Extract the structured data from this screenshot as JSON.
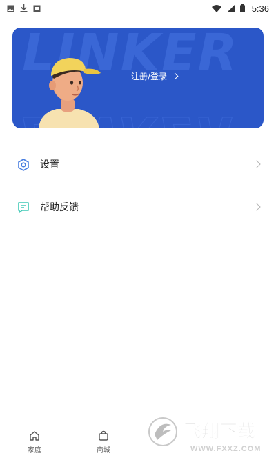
{
  "status_bar": {
    "time": "5:36",
    "left_icons": [
      "image-icon",
      "download-icon",
      "app-notification-icon"
    ],
    "right_icons": [
      "wifi-icon",
      "signal-icon",
      "battery-icon"
    ]
  },
  "banner": {
    "brand_text": "LINKER",
    "login_label": "注册/登录",
    "background_color": "#2b57c8"
  },
  "menu": {
    "items": [
      {
        "label": "设置",
        "icon": "settings-icon",
        "icon_color": "#4a7fe0"
      },
      {
        "label": "帮助反馈",
        "icon": "feedback-icon",
        "icon_color": "#3fc9b6"
      }
    ]
  },
  "tab_bar": {
    "tabs": [
      {
        "label": "家庭",
        "icon": "home-icon"
      },
      {
        "label": "商城",
        "icon": "shop-bag-icon"
      }
    ]
  },
  "watermark": {
    "title": "飞翔下载",
    "subtitle": "WWW.FXXZ.COM"
  }
}
